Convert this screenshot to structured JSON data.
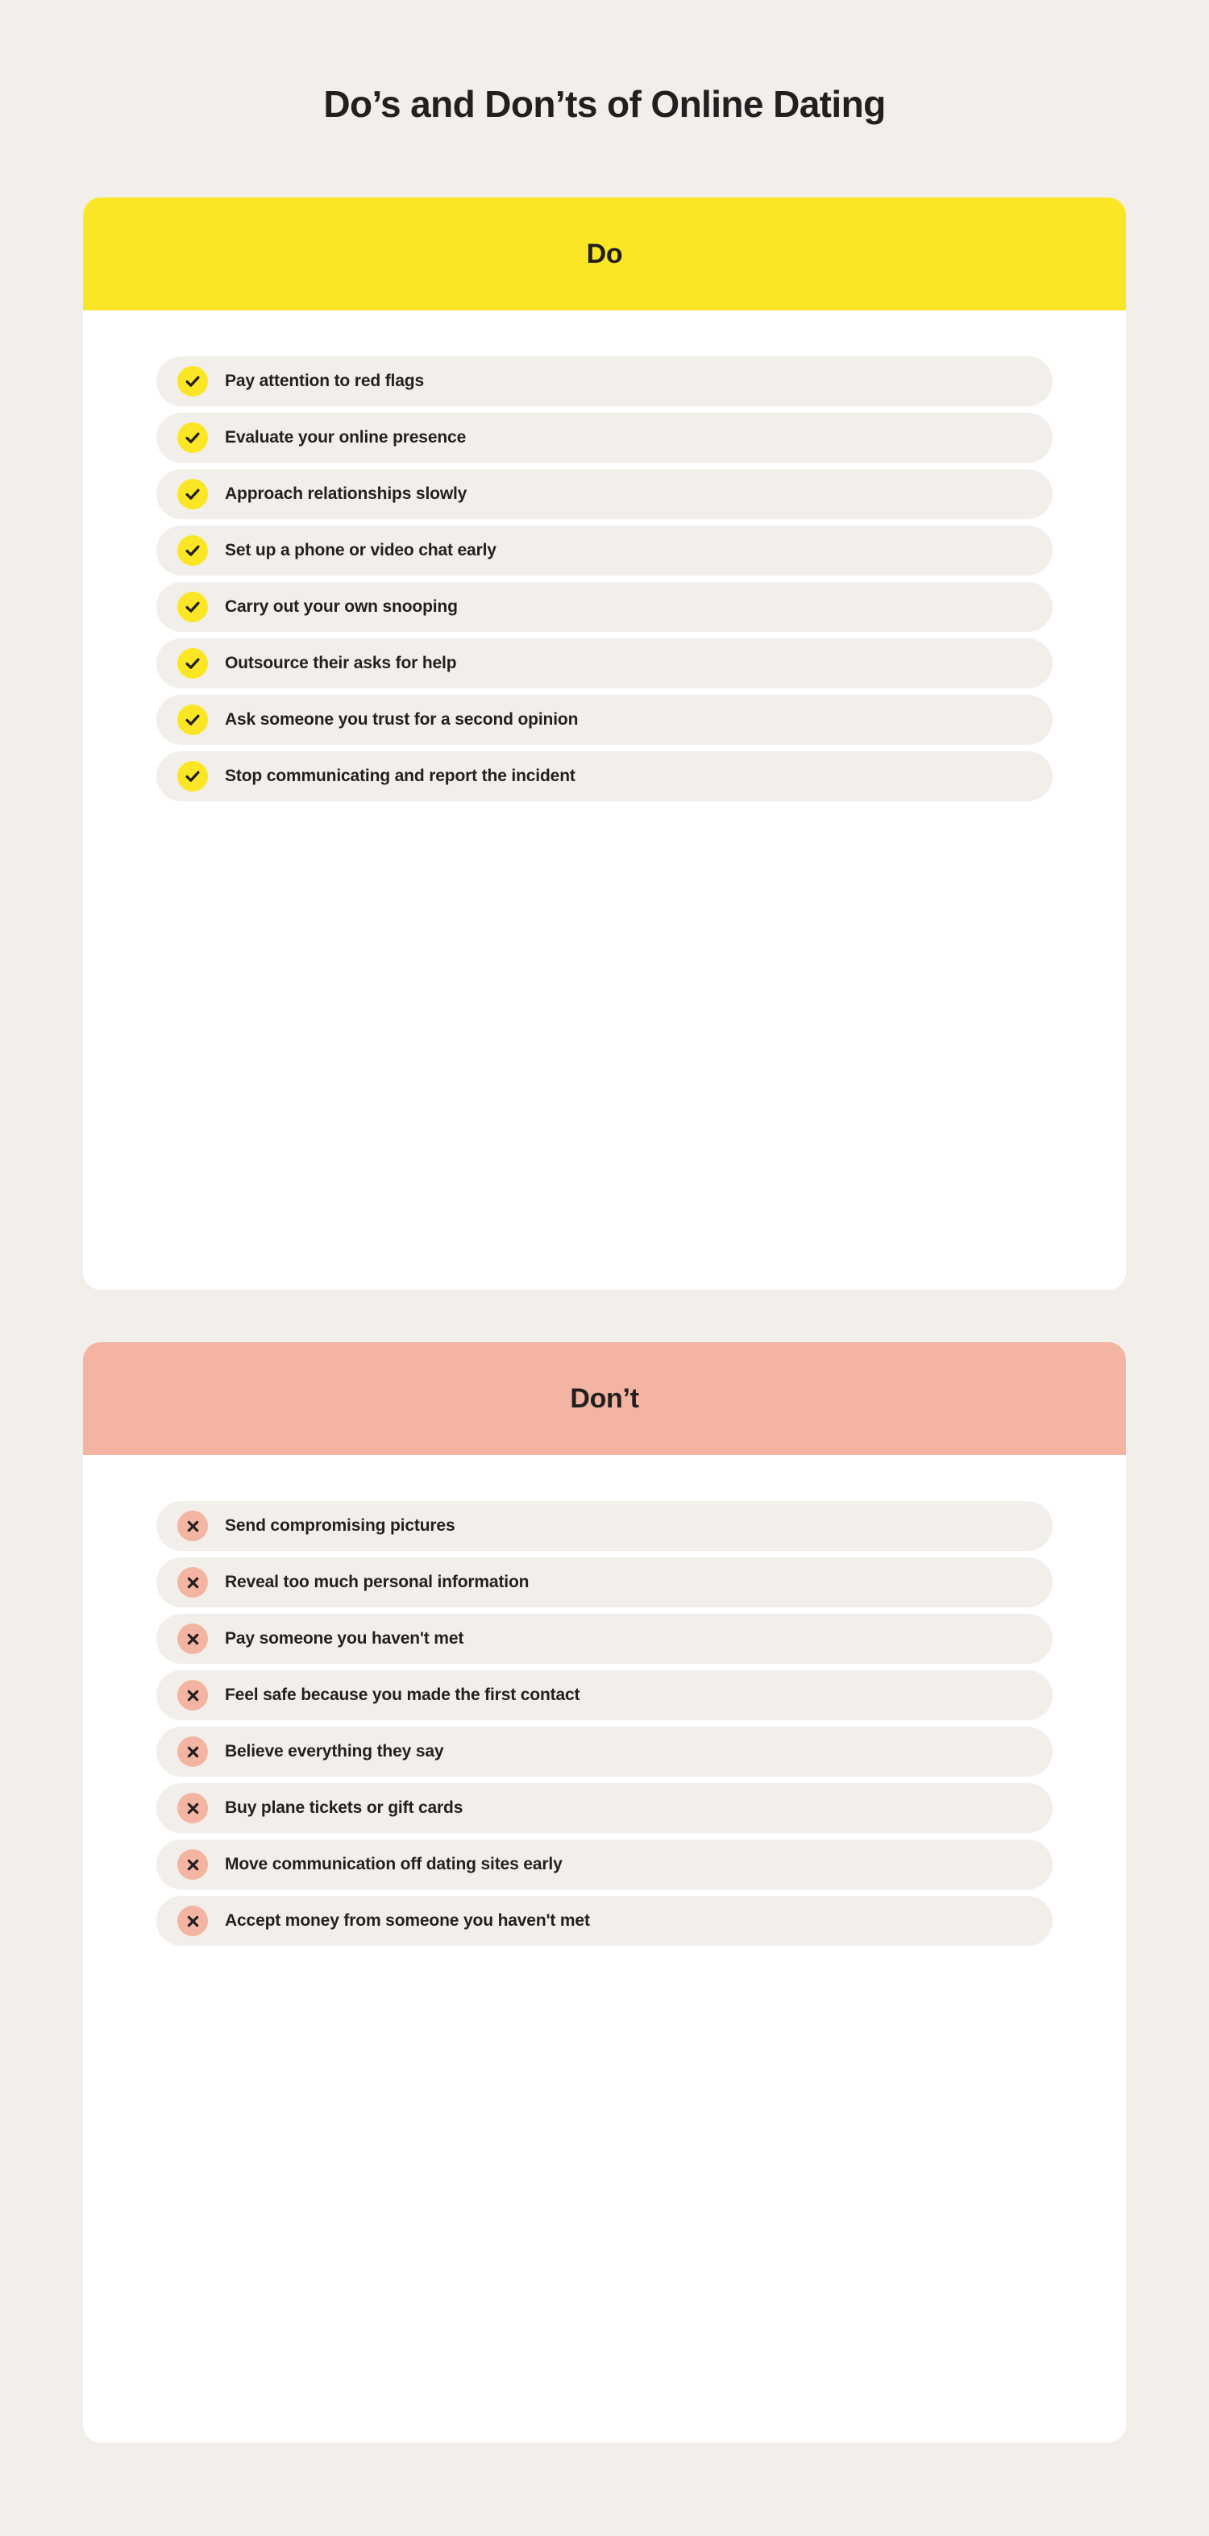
{
  "title": "Do’s and Don’ts of Online Dating",
  "colors": {
    "page_background": "#F2EFEA",
    "card_background": "#FFFFFF",
    "do_header": "#FBE625",
    "dont_header": "#F3B5A2",
    "row_background": "#F2EFEA",
    "text": "#231F20",
    "check_icon_background": "#FBE625",
    "cross_icon_background": "#F3B5A2"
  },
  "sections": [
    {
      "id": "do",
      "heading": "Do",
      "icon": "check-icon",
      "items": [
        "Pay attention to red flags",
        "Evaluate your online presence",
        "Approach relationships slowly",
        "Set up a phone or video chat early",
        "Carry out your own snooping",
        "Outsource their asks for help",
        "Ask someone you trust for a second opinion",
        "Stop communicating and report the incident"
      ]
    },
    {
      "id": "dont",
      "heading": "Don’t",
      "icon": "cross-icon",
      "items": [
        "Send compromising pictures",
        "Reveal too much personal information",
        "Pay someone you haven't met",
        "Feel safe because you made the first contact",
        "Believe everything they say",
        "Buy plane tickets or gift cards",
        "Move communication off dating sites early",
        "Accept money from someone you haven't met"
      ]
    }
  ]
}
